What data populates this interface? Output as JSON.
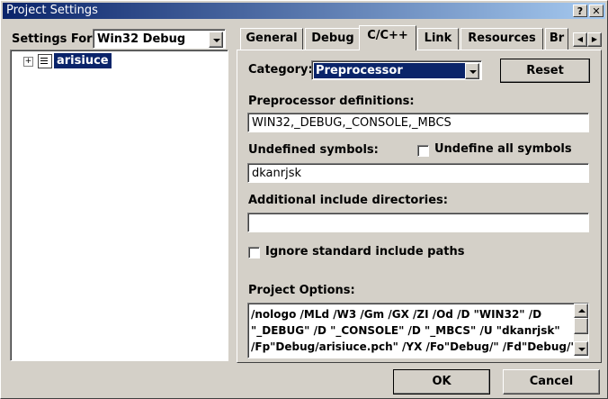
{
  "window": {
    "title": "Project Settings",
    "help": "?",
    "close": "✕"
  },
  "left": {
    "settings_for_label": "Settings For:",
    "settings_for_value": "Win32 Debug",
    "tree_expand": "+",
    "tree_item": "arisiuce"
  },
  "tabs": [
    {
      "label": "General"
    },
    {
      "label": "Debug"
    },
    {
      "label": "C/C++"
    },
    {
      "label": "Link"
    },
    {
      "label": "Resources"
    },
    {
      "label": "Br"
    }
  ],
  "tab_scroll": {
    "left": "◀",
    "right": "▶"
  },
  "category": {
    "label": "Category:",
    "value": "Preprocessor"
  },
  "reset_button": "Reset",
  "preprocessor": {
    "label": "Preprocessor definitions:",
    "value": "WIN32,_DEBUG,_CONSOLE,_MBCS"
  },
  "undefined_symbols": {
    "label": "Undefined symbols:",
    "value": "dkanrjsk"
  },
  "undefine_all": {
    "label": "Undefine all symbols",
    "checked": false
  },
  "include_dirs": {
    "label": "Additional include directories:",
    "value": ""
  },
  "ignore_std": {
    "label": "Ignore standard include paths",
    "checked": false
  },
  "project_options": {
    "label": "Project Options:",
    "lines": [
      "/nologo /MLd /W3 /Gm /GX /ZI /Od /D \"WIN32\" /D",
      "\"_DEBUG\" /D \"_CONSOLE\" /D \"_MBCS\" /U \"dkanrjsk\"",
      "/Fp\"Debug/arisiuce.pch\" /YX /Fo\"Debug/\" /Fd\"Debug/\""
    ]
  },
  "ok_button": "OK",
  "cancel_button": "Cancel"
}
